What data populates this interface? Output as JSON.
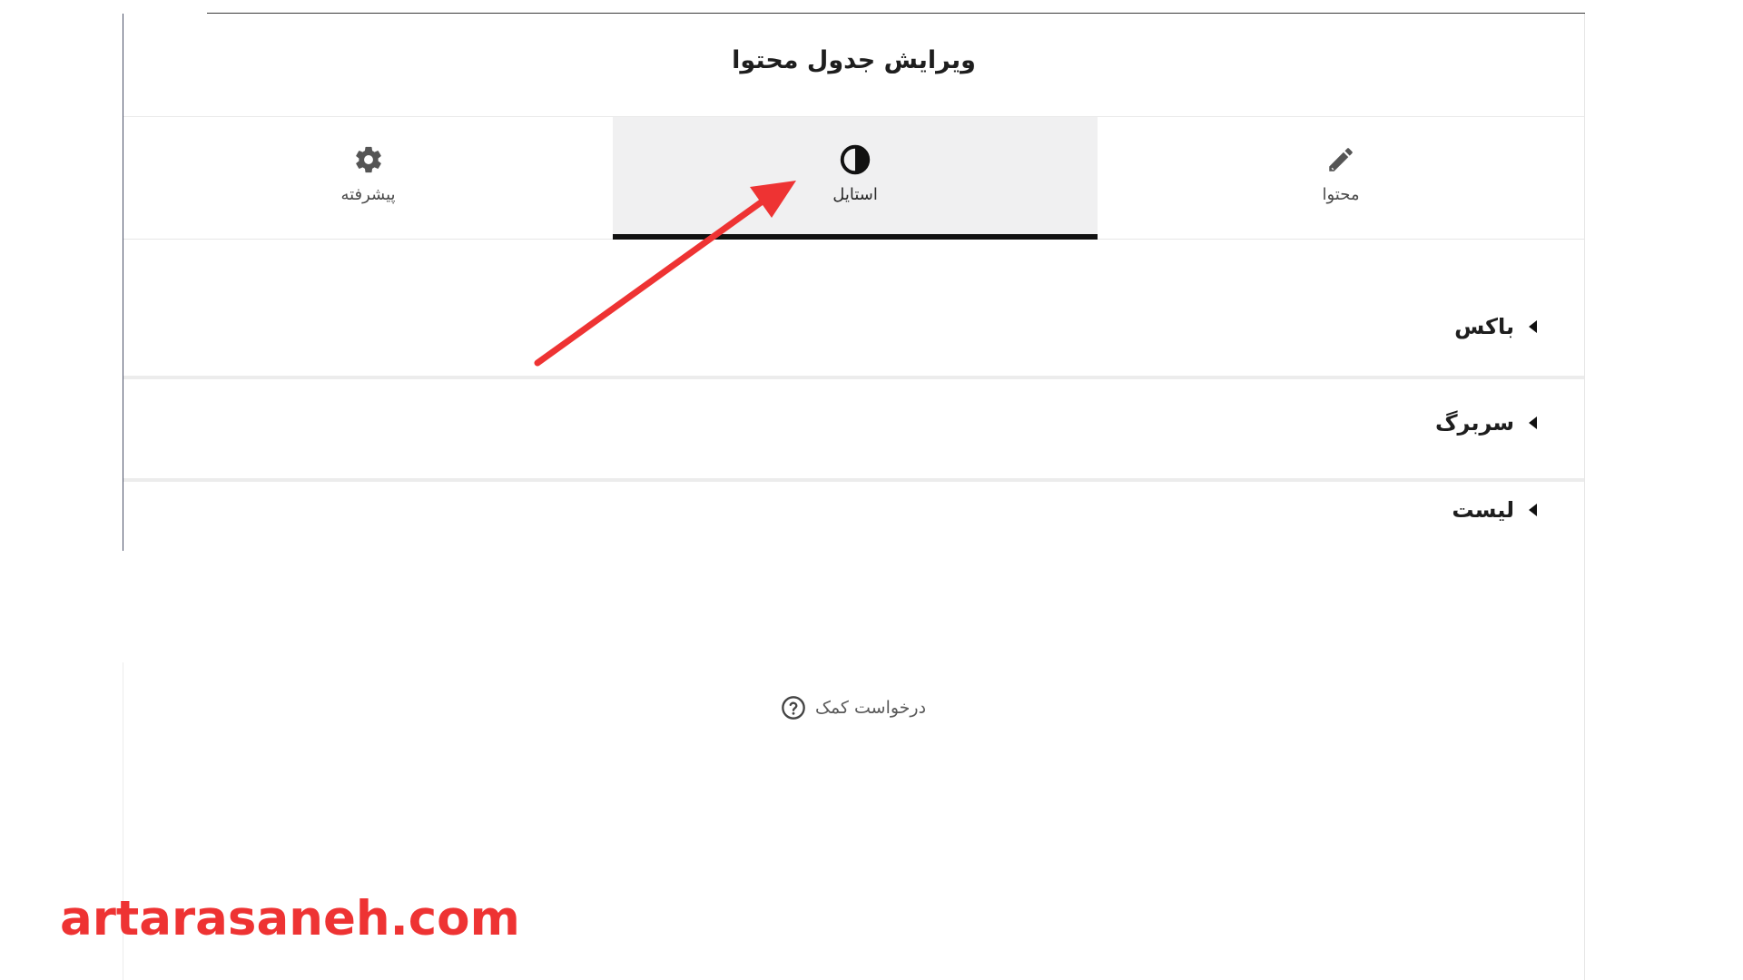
{
  "header": {
    "title": "ویرایش جدول محتوا"
  },
  "tabs": [
    {
      "label": "محتوا",
      "icon": "pencil-icon",
      "active": false
    },
    {
      "label": "استایل",
      "icon": "contrast-icon",
      "active": true
    },
    {
      "label": "پیشرفته",
      "icon": "gear-icon",
      "active": false
    }
  ],
  "sections": [
    {
      "title": "باکس",
      "expanded": false
    },
    {
      "title": "سربرگ",
      "expanded": false
    },
    {
      "title": "لیست",
      "expanded": false
    }
  ],
  "help": {
    "label": "درخواست کمک",
    "icon": "question-circle-icon"
  },
  "annotation": {
    "arrow_color": "#ee3333",
    "points_to": "tab-style"
  },
  "watermark": {
    "text": "artarasaneh.com",
    "color": "#ee3333"
  }
}
